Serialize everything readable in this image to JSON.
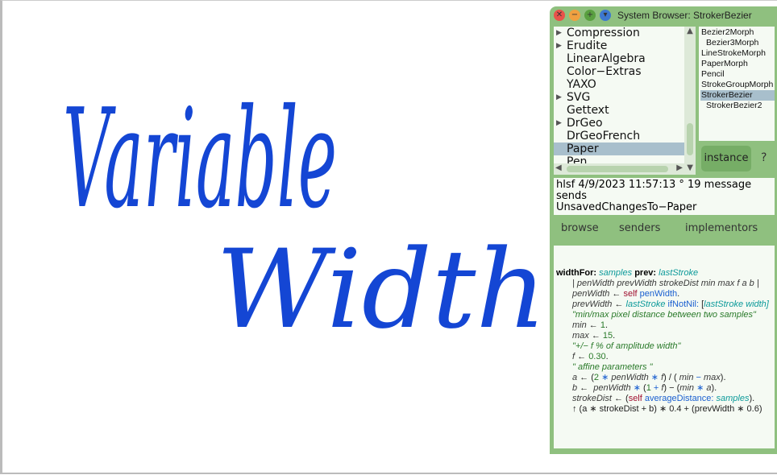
{
  "canvas": {
    "handwriting_lines": [
      "Variable",
      "Width"
    ],
    "ink_color": "#1446d4"
  },
  "window": {
    "title": "System Browser: StrokerBezier",
    "buttons": [
      {
        "name": "close",
        "color": "#e8524a",
        "glyph": "✕"
      },
      {
        "name": "minimize",
        "color": "#f0a040",
        "glyph": "−"
      },
      {
        "name": "maximize",
        "color": "#5aa040",
        "glyph": "+"
      },
      {
        "name": "menu",
        "color": "#3d78d0",
        "glyph": "▾"
      }
    ],
    "packages": [
      {
        "label": "Compression",
        "tri": true
      },
      {
        "label": "Erudite",
        "tri": true
      },
      {
        "label": "LinearAlgebra",
        "tri": false
      },
      {
        "label": "Color−Extras",
        "tri": false
      },
      {
        "label": "YAXO",
        "tri": false
      },
      {
        "label": "SVG",
        "tri": true
      },
      {
        "label": "Gettext",
        "tri": false
      },
      {
        "label": "DrGeo",
        "tri": true
      },
      {
        "label": "DrGeoFrench",
        "tri": false
      },
      {
        "label": "Paper",
        "tri": false,
        "selected": true
      },
      {
        "label": "Pen",
        "tri": false
      }
    ],
    "classes": [
      {
        "label": "Bezier2Morph",
        "indent": false
      },
      {
        "label": "Bezier3Morph",
        "indent": true
      },
      {
        "label": "LineStrokeMorph",
        "indent": false
      },
      {
        "label": "PaperMorph",
        "indent": false
      },
      {
        "label": "Pencil",
        "indent": false
      },
      {
        "label": "StrokeGroupMorph",
        "indent": false
      },
      {
        "label": "StrokerBezier",
        "indent": false,
        "selected": true
      },
      {
        "label": "StrokerBezier2",
        "indent": true
      }
    ],
    "instance_label": "instance",
    "help_label": "?",
    "comment": [
      "hlsf 4/9/2023 11:57:13 ° 19 message sends",
      "UnsavedChangesTo−Paper"
    ],
    "actions": [
      "browse",
      "senders",
      "implementors"
    ],
    "colors": {
      "kw": "#000000",
      "arg": "#0c9a9a",
      "tmp": "#3a3a3a",
      "self": "#a01030",
      "msg": "#1a5fd0",
      "num": "#2a7a2a",
      "cmt": "#2a7a2a",
      "op": "#222222"
    },
    "code": [
      [
        [
          "widthFor: ",
          "kw"
        ],
        [
          "samples ",
          "arg"
        ],
        [
          "prev: ",
          "kw"
        ],
        [
          "lastStroke",
          "arg"
        ]
      ],
      [
        [
          "| penWidth prevWidth strokeDist min max f a b |",
          "tmp"
        ]
      ],
      [
        [
          "penWidth",
          "tmp"
        ],
        [
          " ← ",
          "op"
        ],
        [
          "self",
          "self"
        ],
        [
          " penWidth",
          "msg"
        ],
        [
          ".",
          "op"
        ]
      ],
      [
        [
          "prevWidth",
          "tmp"
        ],
        [
          " ← ",
          "op"
        ],
        [
          "lastStroke",
          "arg"
        ],
        [
          " ifNotNil: ",
          "msg"
        ],
        [
          "[",
          "op"
        ],
        [
          "lastStroke width]",
          "arg"
        ]
      ],
      [
        [
          "\"min/max pixel distance between two samples\"",
          "cmt"
        ]
      ],
      [
        [
          "min",
          "tmp"
        ],
        [
          " ← ",
          "op"
        ],
        [
          "1",
          "num"
        ],
        [
          ".",
          "op"
        ]
      ],
      [
        [
          "max",
          "tmp"
        ],
        [
          " ← ",
          "op"
        ],
        [
          "15",
          "num"
        ],
        [
          ".",
          "op"
        ]
      ],
      [
        [
          "\"+/− f % of amplitude width\"",
          "cmt"
        ]
      ],
      [
        [
          "f",
          "tmp"
        ],
        [
          " ← ",
          "op"
        ],
        [
          "0.30",
          "num"
        ],
        [
          ".",
          "op"
        ]
      ],
      [
        [
          "\" affine parameters \"",
          "cmt"
        ]
      ],
      [
        [
          "a",
          "tmp"
        ],
        [
          " ← (",
          "op"
        ],
        [
          "2",
          "num"
        ],
        [
          " ∗ ",
          "msg"
        ],
        [
          "penWidth",
          "tmp"
        ],
        [
          " ∗ ",
          "msg"
        ],
        [
          "f",
          "tmp"
        ],
        [
          ") / ( ",
          "op"
        ],
        [
          "min",
          "tmp"
        ],
        [
          " − ",
          "msg"
        ],
        [
          "max",
          "tmp"
        ],
        [
          ").",
          "op"
        ]
      ],
      [
        [
          "b",
          "tmp"
        ],
        [
          " ←  ",
          "op"
        ],
        [
          "penWidth",
          "tmp"
        ],
        [
          " ∗ ",
          "msg"
        ],
        [
          "(",
          "op"
        ],
        [
          "1",
          "num"
        ],
        [
          " + ",
          "msg"
        ],
        [
          "f",
          "tmp"
        ],
        [
          ") − (",
          "op"
        ],
        [
          "min",
          "tmp"
        ],
        [
          " ∗ ",
          "msg"
        ],
        [
          "a",
          "tmp"
        ],
        [
          ").",
          "op"
        ]
      ],
      [
        [
          "strokeDist",
          "tmp"
        ],
        [
          " ← (",
          "op"
        ],
        [
          "self",
          "self"
        ],
        [
          " averageDistance: ",
          "msg"
        ],
        [
          "samples",
          "arg"
        ],
        [
          ").",
          "op"
        ]
      ],
      [
        [
          "↑ (a ∗ strokeDist + b) ∗ 0.4 + (prevWidth ∗ 0.6)",
          "op"
        ]
      ]
    ]
  }
}
